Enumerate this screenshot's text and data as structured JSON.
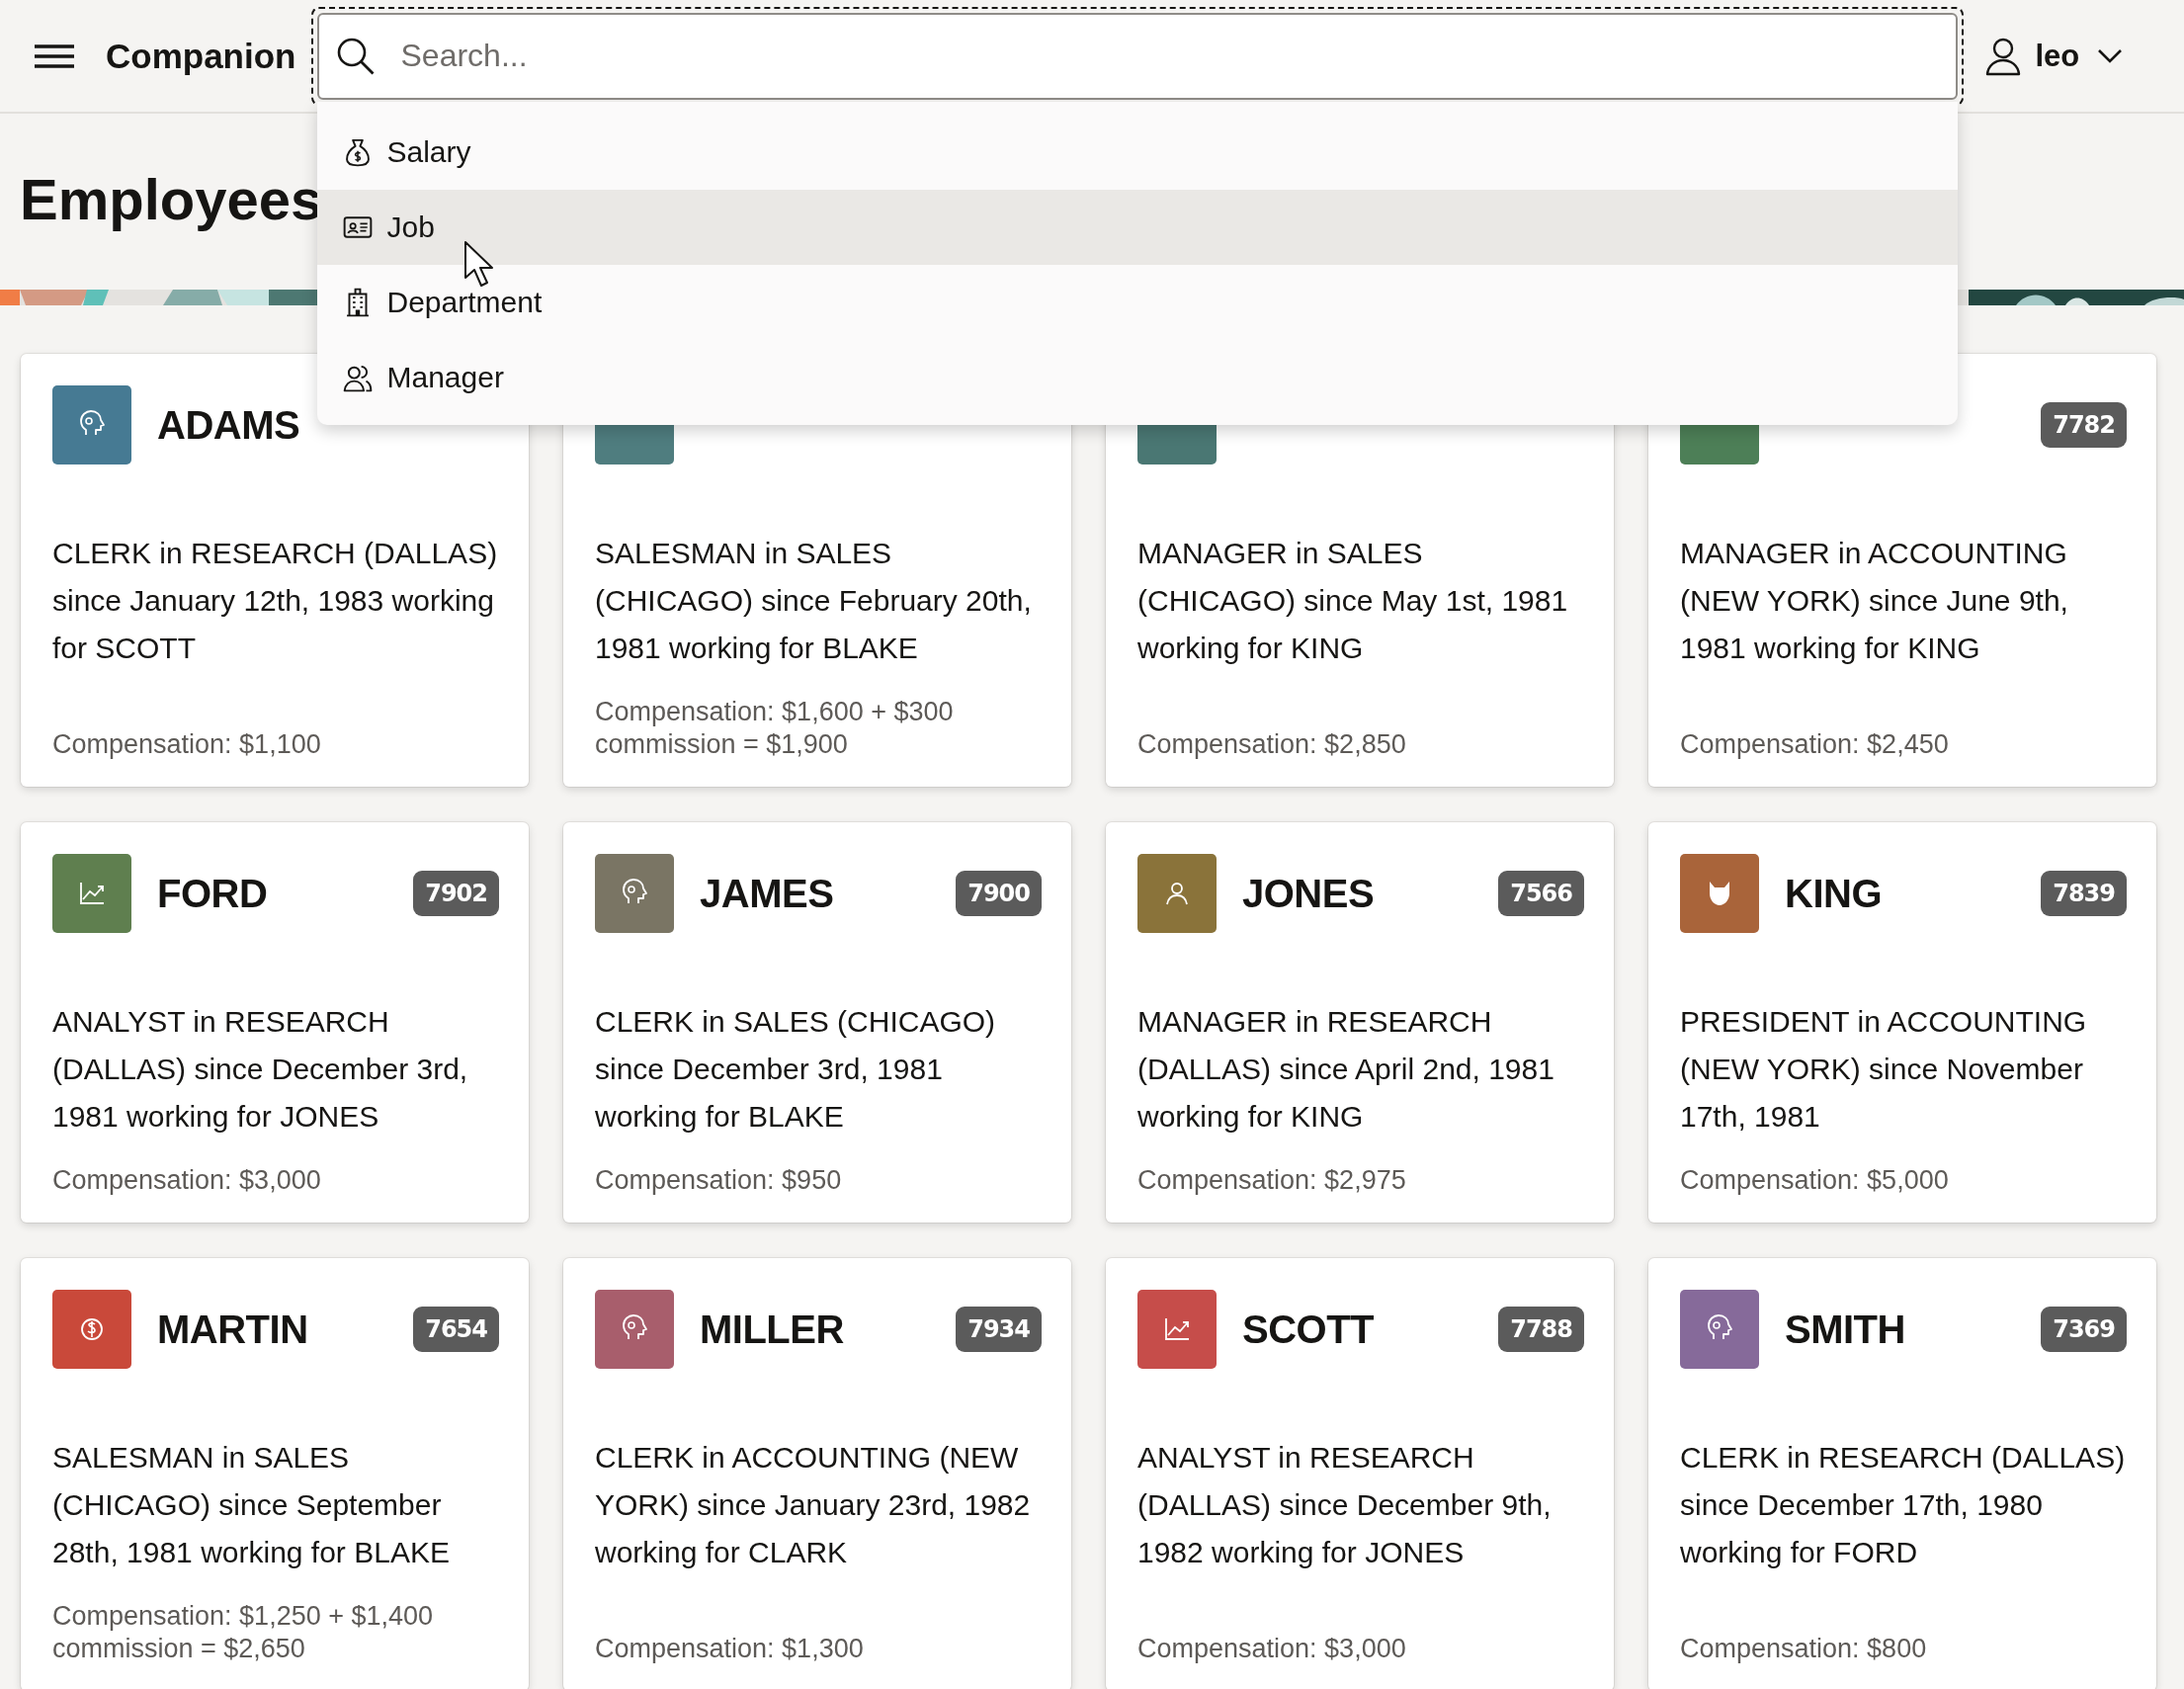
{
  "header": {
    "title": "Companion",
    "search": {
      "placeholder": "Search...",
      "focused": true
    },
    "user": "leo"
  },
  "search_menu": [
    {
      "label": "Salary",
      "kind": "money-bag",
      "selected": false
    },
    {
      "label": "Job",
      "kind": "id-card",
      "selected": true
    },
    {
      "label": "Department",
      "kind": "building",
      "selected": false
    },
    {
      "label": "Manager",
      "kind": "people",
      "selected": false
    }
  ],
  "page_title": "Employees",
  "employees": [
    {
      "name": "ADAMS",
      "kind": "head",
      "color": "#467a93",
      "description": "CLERK in RESEARCH (DALLAS) since January 12th, 1983 working for SCOTT",
      "compensation": "Compensation: $1,100"
    },
    {
      "color": "#4f7d7f",
      "description": "SALESMAN in SALES (CHICAGO) since February 20th, 1981 working for BLAKE",
      "compensation": "Compensation: $1,600 + $300 commission = $1,900"
    },
    {
      "color": "#4a7773",
      "description": "MANAGER in SALES (CHICAGO) since May 1st, 1981 working for KING",
      "compensation": "Compensation: $2,850"
    },
    {
      "number": "7782",
      "color": "#4d7f57",
      "description": "MANAGER in ACCOUNTING (NEW YORK) since June 9th, 1981 working for KING",
      "compensation": "Compensation: $2,450"
    },
    {
      "name": "FORD",
      "number": "7902",
      "kind": "chart",
      "color": "#5f7f4f",
      "description": "ANALYST in RESEARCH (DALLAS) since December 3rd, 1981 working for JONES",
      "compensation": "Compensation: $3,000"
    },
    {
      "name": "JAMES",
      "number": "7900",
      "kind": "head",
      "color": "#7a7564",
      "description": "CLERK in SALES (CHICAGO) since December 3rd, 1981 working for BLAKE",
      "compensation": "Compensation: $950"
    },
    {
      "name": "JONES",
      "number": "7566",
      "kind": "person",
      "color": "#8a733a",
      "description": "MANAGER in RESEARCH (DALLAS) since April 2nd, 1981 working for KING",
      "compensation": "Compensation: $2,975"
    },
    {
      "name": "KING",
      "number": "7839",
      "kind": "devil",
      "color": "#a9643a",
      "description": "PRESIDENT in ACCOUNTING (NEW YORK) since November 17th, 1981",
      "compensation": "Compensation: $5,000"
    },
    {
      "name": "MARTIN",
      "number": "7654",
      "kind": "coin",
      "color": "#c9493a",
      "description": "SALESMAN in SALES (CHICAGO) since September 28th, 1981 working for BLAKE",
      "compensation": "Compensation: $1,250 + $1,400 commission = $2,650"
    },
    {
      "name": "MILLER",
      "number": "7934",
      "kind": "head",
      "color": "#a85e6c",
      "description": "CLERK in ACCOUNTING (NEW YORK) since January 23rd, 1982 working for CLARK",
      "compensation": "Compensation: $1,300"
    },
    {
      "name": "SCOTT",
      "number": "7788",
      "kind": "chart",
      "color": "#c64d4a",
      "description": "ANALYST in RESEARCH (DALLAS) since December 9th, 1982 working for JONES",
      "compensation": "Compensation: $3,000"
    },
    {
      "name": "SMITH",
      "number": "7369",
      "kind": "head",
      "color": "#866a9a",
      "description": "CLERK in RESEARCH (DALLAS) since December 17th, 1980 working for FORD",
      "compensation": "Compensation: $800"
    }
  ]
}
